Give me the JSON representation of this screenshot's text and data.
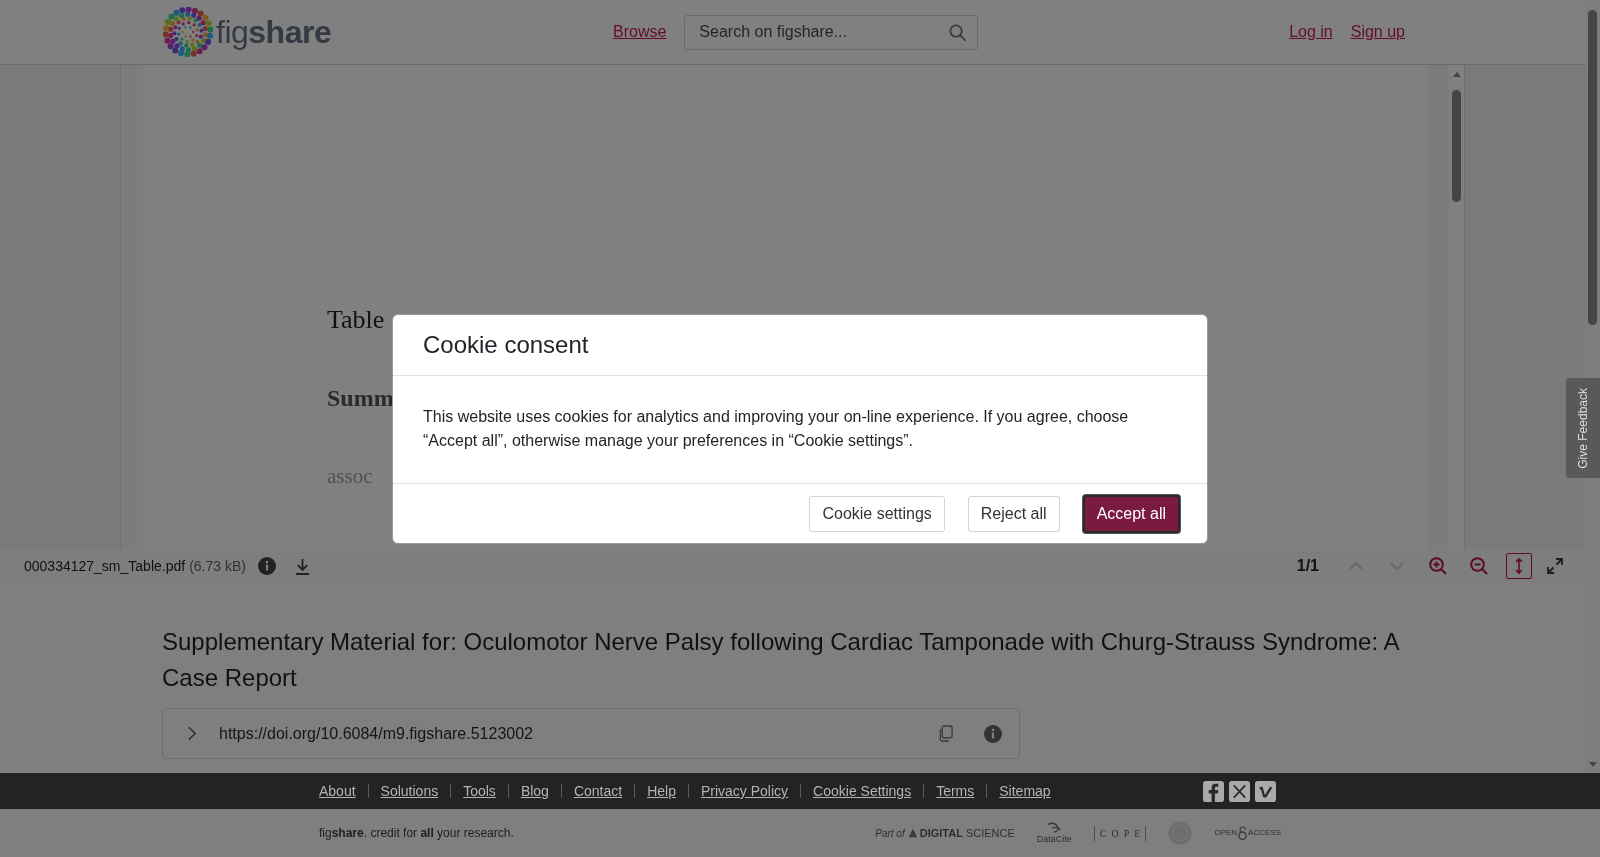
{
  "header": {
    "logo": "fig**share**",
    "nav": [
      {
        "label": "Browse"
      }
    ],
    "search": {
      "placeholder": "Search on figshare..."
    },
    "auth_links": [
      {
        "label": "Log in"
      },
      {
        "label": "Sign up"
      }
    ]
  },
  "viewer": {
    "page_texts": [
      {
        "kind": "heading",
        "text": "Table"
      },
      {
        "kind": "subheading",
        "text": "Summ"
      },
      {
        "kind": "body",
        "text": "assoc"
      }
    ],
    "toolbar": {
      "file_name": "000334127_sm_Table.pdf",
      "file_size": "(6.73 kB)",
      "page_indicator": "1/1",
      "controls": [
        {
          "kind": "prev-page",
          "disabled": true,
          "active": false
        },
        {
          "kind": "next-page",
          "disabled": true,
          "active": false
        },
        {
          "kind": "zoom-in",
          "disabled": false,
          "active": false
        },
        {
          "kind": "zoom-out",
          "disabled": false,
          "active": false
        },
        {
          "kind": "fit-height",
          "disabled": false,
          "active": true
        },
        {
          "kind": "fullscreen",
          "disabled": false,
          "active": false
        }
      ]
    }
  },
  "item": {
    "title": "Supplementary Material for: Oculomotor Nerve Palsy following Cardiac Tamponade with Churg-Strauss Syndrome: A Case Report",
    "doi": "https://doi.org/10.6084/m9.figshare.5123002"
  },
  "feedback_tab": {
    "label": "Give Feedback"
  },
  "footer": {
    "links": [
      "About",
      "Solutions",
      "Tools",
      "Blog",
      "Contact",
      "Help",
      "Privacy Policy",
      "Cookie Settings",
      "Terms",
      "Sitemap"
    ],
    "social": [
      {
        "kind": "facebook"
      },
      {
        "kind": "x"
      },
      {
        "kind": "vimeo"
      }
    ],
    "tagline": "fig**share**. credit for **all** your research.",
    "partners": [
      {
        "kind": "digital-science",
        "texts": [
          "Part of",
          "**DIGITAL** SCIENCE"
        ]
      },
      {
        "kind": "datacite",
        "texts": [
          "DataCite"
        ]
      },
      {
        "kind": "cope",
        "texts": [
          "COPE"
        ]
      },
      {
        "kind": "seal"
      },
      {
        "kind": "open-access",
        "texts": [
          "OPEN",
          "ACCESS"
        ]
      }
    ]
  },
  "cookie_dialog": {
    "title": "Cookie consent",
    "message": "This website uses cookies for analytics and improving your on-line experience. If you agree, choose “Accept all”, otherwise manage your preferences in “Cookie settings”.",
    "buttons": [
      {
        "label": "Cookie settings",
        "kind": "secondary"
      },
      {
        "label": "Reject all",
        "kind": "secondary"
      },
      {
        "label": "Accept all",
        "kind": "primary"
      }
    ]
  }
}
